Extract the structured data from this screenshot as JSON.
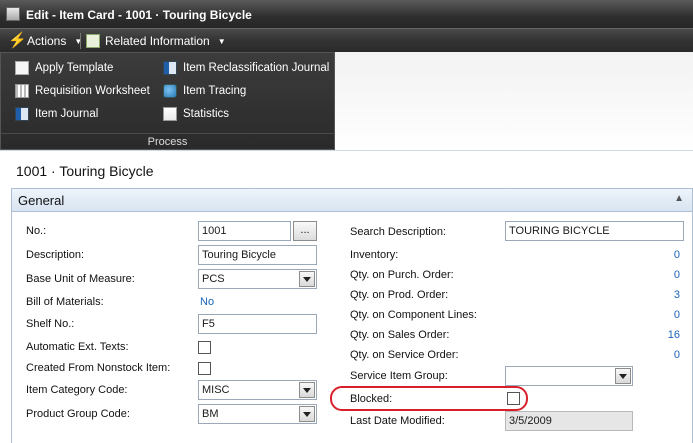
{
  "window": {
    "title": "Edit - Item Card - 1001 · Touring Bicycle"
  },
  "commandbar": {
    "actions_label": "Actions",
    "related_label": "Related Information"
  },
  "ribbon": {
    "items": [
      {
        "label": "Apply Template",
        "icon": "template-icon"
      },
      {
        "label": "Requisition Worksheet",
        "icon": "worksheet-icon"
      },
      {
        "label": "Item Journal",
        "icon": "journal-icon"
      },
      {
        "label": "Item Reclassification Journal",
        "icon": "reclass-journal-icon"
      },
      {
        "label": "Item Tracing",
        "icon": "tracing-icon"
      },
      {
        "label": "Statistics",
        "icon": "statistics-icon"
      }
    ],
    "group_label": "Process"
  },
  "page": {
    "title": "1001 · Touring Bicycle"
  },
  "general": {
    "header": "General",
    "left": {
      "no_label": "No.:",
      "no_value": "1001",
      "description_label": "Description:",
      "description_value": "Touring Bicycle",
      "base_unit_label": "Base Unit of Measure:",
      "base_unit_value": "PCS",
      "bom_label": "Bill of Materials:",
      "bom_value": "No",
      "shelf_label": "Shelf No.:",
      "shelf_value": "F5",
      "auto_ext_label": "Automatic Ext. Texts:",
      "nonstock_label": "Created From Nonstock Item:",
      "category_label": "Item Category Code:",
      "category_value": "MISC",
      "product_group_label": "Product Group Code:",
      "product_group_value": "BM"
    },
    "right": {
      "search_desc_label": "Search Description:",
      "search_desc_value": "TOURING BICYCLE",
      "inventory_label": "Inventory:",
      "inventory_value": "0",
      "purch_order_label": "Qty. on Purch. Order:",
      "purch_order_value": "0",
      "prod_order_label": "Qty. on Prod. Order:",
      "prod_order_value": "3",
      "component_label": "Qty. on Component Lines:",
      "component_value": "0",
      "sales_order_label": "Qty. on Sales Order:",
      "sales_order_value": "16",
      "service_order_label": "Qty. on Service Order:",
      "service_order_value": "0",
      "service_group_label": "Service Item Group:",
      "service_group_value": "",
      "blocked_label": "Blocked:",
      "last_modified_label": "Last Date Modified:",
      "last_modified_value": "3/5/2009"
    }
  },
  "colors": {
    "link": "#1a63b8",
    "highlight": "#d8202a",
    "header_dark": "#2e2e2e"
  }
}
